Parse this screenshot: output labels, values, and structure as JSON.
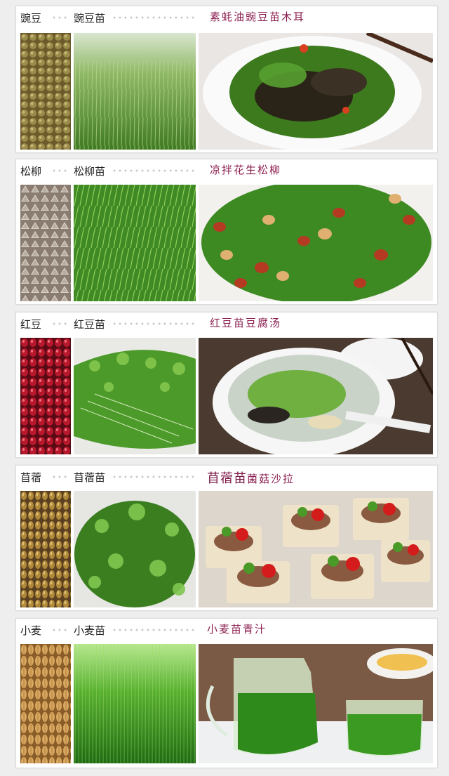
{
  "rows": [
    {
      "seed": "豌豆",
      "sprout": "豌豆苗",
      "dish_prefix": "",
      "dish": "素蚝油豌豆苗木耳"
    },
    {
      "seed": "松柳",
      "sprout": "松柳苗",
      "dish_prefix": "",
      "dish": "凉拌花生松柳"
    },
    {
      "seed": "红豆",
      "sprout": "红豆苗",
      "dish_prefix": "",
      "dish": "红豆苗豆腐汤"
    },
    {
      "seed": "苜蓿",
      "sprout": "苜蓿苗",
      "dish_prefix": "苜蓿苗",
      "dish": "菌菇沙拉"
    },
    {
      "seed": "小麦",
      "sprout": "小麦苗",
      "dish_prefix": "",
      "dish": "小麦苗青汁"
    }
  ],
  "colors": {
    "dish_title": "#8b1d4f",
    "card_bg": "#ffffff",
    "page_bg": "#efeeee"
  },
  "icons": [
    "pea-seeds-photo",
    "pea-sprouts-photo",
    "pea-dish-photo",
    "buckwheat-seeds-photo",
    "buckwheat-sprouts-photo",
    "peanut-salad-photo",
    "red-bean-seeds-photo",
    "red-bean-sprouts-photo",
    "tofu-soup-photo",
    "alfalfa-seeds-photo",
    "alfalfa-sprouts-photo",
    "mushroom-salad-photo",
    "wheat-seeds-photo",
    "wheatgrass-photo",
    "wheatgrass-juice-photo"
  ]
}
